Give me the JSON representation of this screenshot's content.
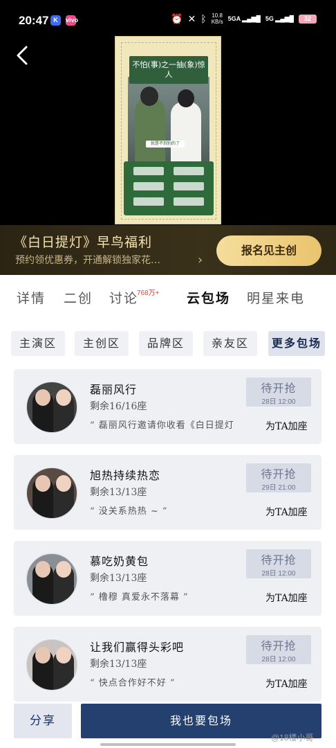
{
  "status_bar": {
    "time": "20:47",
    "app_k": "K",
    "app_v": "vivo",
    "net_speed_value": "10.8",
    "net_speed_unit": "KB/s",
    "signal1": "5GA",
    "signal2": "5G",
    "battery": "32"
  },
  "poster": {
    "title_text": "不怕(事)之一抽(象)惊人",
    "tag": "就是不到别的了"
  },
  "promo": {
    "title": "《白日提灯》早鸟福利",
    "subtitle": "预约领优惠券，开通解锁独家花…",
    "button": "报名见主创"
  },
  "tabs": [
    {
      "label": "详情"
    },
    {
      "label": "二创"
    },
    {
      "label": "讨论"
    },
    {
      "label": "云包场"
    },
    {
      "label": "明星来电"
    }
  ],
  "discuss_badge": "768万+",
  "chips": [
    "主演区",
    "主创区",
    "品牌区",
    "亲友区",
    "更多包场"
  ],
  "cards": [
    {
      "name": "磊丽风行",
      "seats": "剩余16/16座",
      "quote": "“ 磊丽风行邀请你收看《白日提灯",
      "btn_label": "待开抢",
      "btn_time": "28日 12:00",
      "add": "为TA加座"
    },
    {
      "name": "旭热持续热恋",
      "seats": "剩余13/13座",
      "quote": "“ 没关系热热 ~ ”",
      "btn_label": "待开抢",
      "btn_time": "29日 21:00",
      "add": "为TA加座"
    },
    {
      "name": "慕吃奶黄包",
      "seats": "剩余13/13座",
      "quote": "“ 橹穆 真爱永不落幕 ”",
      "btn_label": "待开抢",
      "btn_time": "28日 12:00",
      "add": "为TA加座"
    },
    {
      "name": "让我们赢得头彩吧",
      "seats": "剩余13/13座",
      "quote": "“ 快点合作好不好 ”",
      "btn_label": "待开抢",
      "btn_time": "28日 12:00",
      "add": "为TA加座"
    }
  ],
  "bottom": {
    "share": "分享",
    "main": "我也要包场"
  },
  "watermark": "@18楼小哥"
}
